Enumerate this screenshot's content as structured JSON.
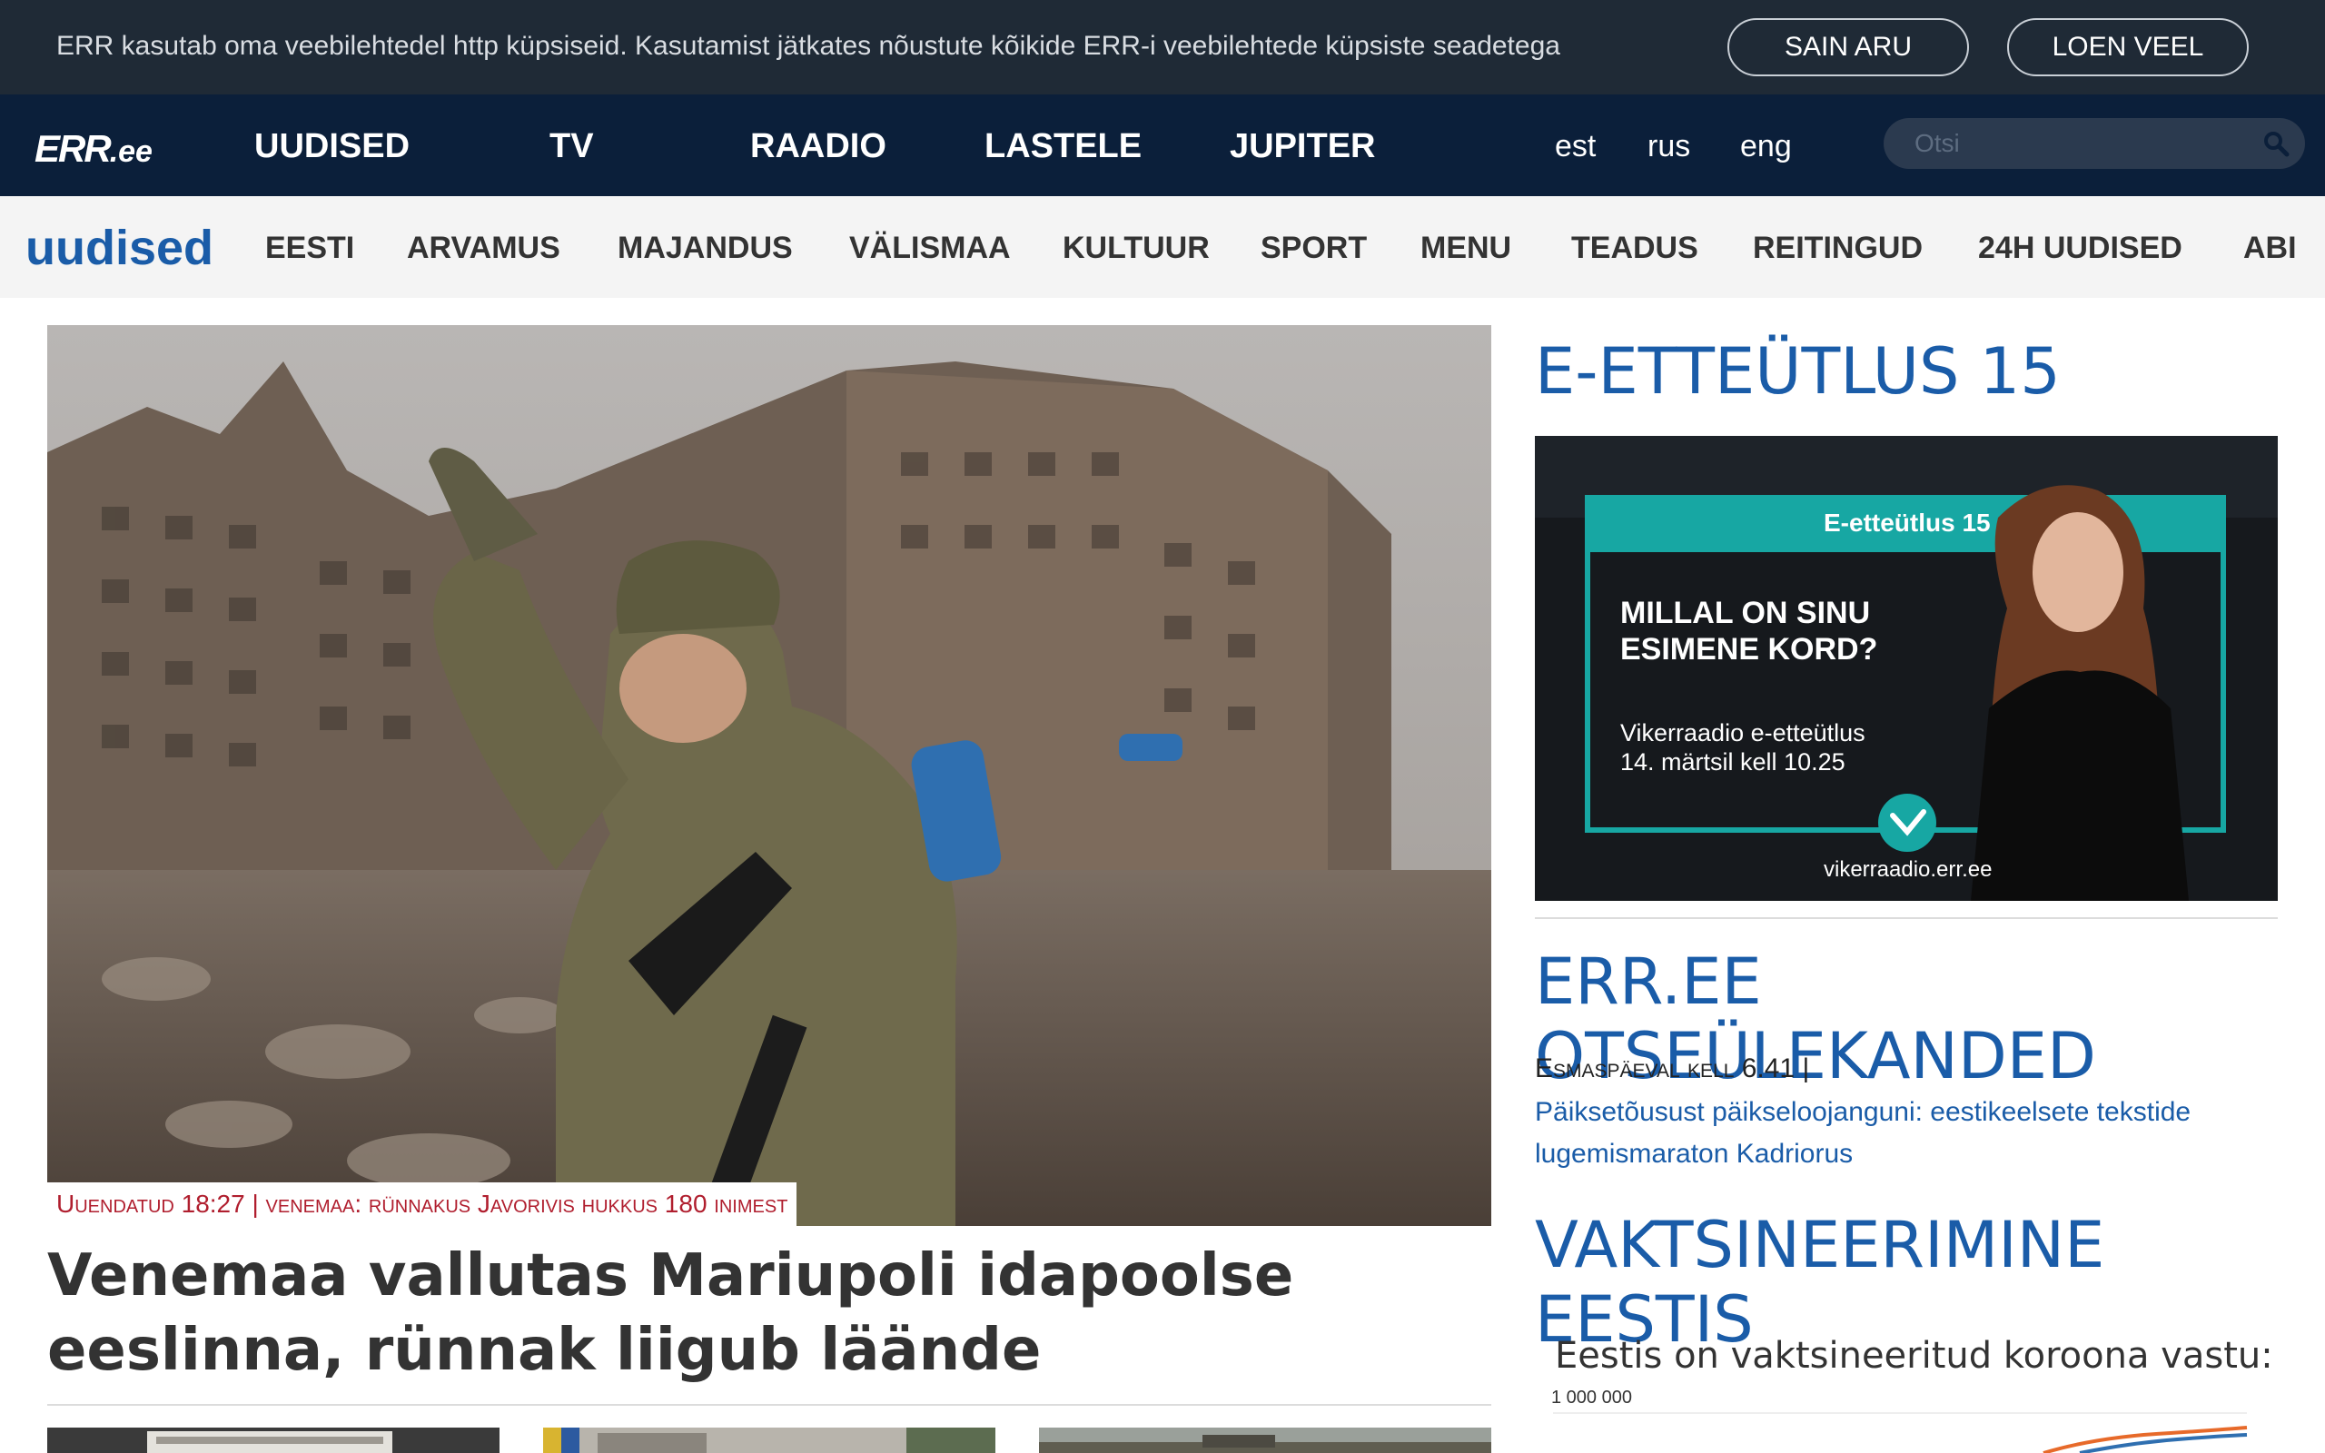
{
  "cookie": {
    "text": "ERR kasutab oma veebilehtedel http küpsiseid. Kasutamist jätkates nõustute kõikide ERR-i veebilehtede küpsiste seadetega",
    "accept_label": "SAIN ARU",
    "more_label": "LOEN VEEL"
  },
  "topnav": {
    "logo": "ERR",
    "logo_suffix": ".ee",
    "items": [
      "UUDISED",
      "TV",
      "RAADIO",
      "LASTELE",
      "JUPITER"
    ],
    "langs": [
      "est",
      "rus",
      "eng"
    ],
    "search_placeholder": "Otsi"
  },
  "secnav": {
    "title": "uudised",
    "items": [
      "EESTI",
      "ARVAMUS",
      "MAJANDUS",
      "VÄLISMAA",
      "KULTUUR",
      "SPORT",
      "MENU",
      "TEADUS",
      "REITINGUD",
      "24H UUDISED",
      "ABI"
    ]
  },
  "hero": {
    "caption": "Uuendatud 18:27 | venemaa: rünnakus Javorivis hukkus 180 inimest",
    "headline": "Venemaa vallutas Mariupoli idapoolse eeslinna, rünnak liigub läände"
  },
  "sidebar": {
    "section1_title": "E-ETTEÜTLUS 15",
    "banner": {
      "label": "E-etteütlus 15",
      "heading_line1": "MILLAL ON SINU",
      "heading_line2": "ESIMENE KORD?",
      "sub_line1": "Vikerraadio e-etteütlus",
      "sub_line2": "14. märtsil kell 10.25",
      "url": "vikerraadio.err.ee",
      "accent": "#17a7a3"
    },
    "section2_title": "ERR.EE OTSEÜLEKANDED",
    "live_when": "Esmaspäeval kell 6.41 |",
    "live_link": "Päiksetõusust päikseloojanguni: eestikeelsete tekstide lugemismaraton Kadriorus",
    "section3_title": "VAKTSINEERIMINE EESTIS",
    "vax_title": "Eestis on vaktsineeritud koroona vastu:",
    "vax_tick": "1 000 000"
  },
  "colors": {
    "cookie_bg": "#1f2a36",
    "nav_bg": "#0b1f3a",
    "accent_blue": "#1a5ca8",
    "caption_red": "#b01e2e"
  }
}
